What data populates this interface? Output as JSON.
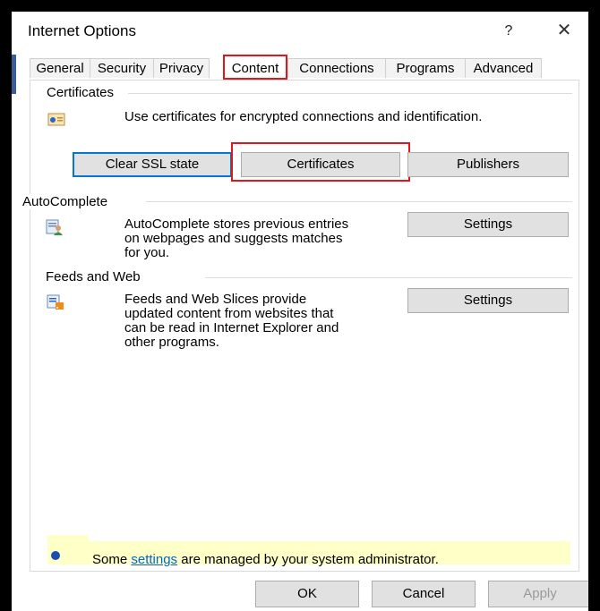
{
  "window": {
    "title": "Internet Options",
    "help_label": "?",
    "close_label": "✕"
  },
  "tabs": [
    {
      "label": "General"
    },
    {
      "label": "Security"
    },
    {
      "label": "Privacy"
    },
    {
      "label": "Content"
    },
    {
      "label": "Connections"
    },
    {
      "label": "Programs"
    },
    {
      "label": "Advanced"
    }
  ],
  "active_tab": "Content",
  "certificates": {
    "title": "Certificates",
    "description": "Use certificates for encrypted connections and identification.",
    "buttons": {
      "clear_ssl": "Clear SSL state",
      "certificates": "Certificates",
      "publishers": "Publishers"
    },
    "icon": "certificate-icon"
  },
  "autocomplete": {
    "title": "AutoComplete",
    "description": "AutoComplete stores previous entries\non webpages and suggests matches\nfor you.",
    "settings_label": "Settings",
    "icon": "autocomplete-icon"
  },
  "feeds": {
    "title": "Feeds and Web",
    "description": "Feeds and Web Slices provide\nupdated content from websites that\ncan be read in Internet Explorer and\nother programs.",
    "settings_label": "Settings",
    "icon": "feeds-icon"
  },
  "admin_notice": {
    "prefix": "Some ",
    "link": "settings",
    "suffix": " are managed by your system administrator.",
    "icon": "info-icon"
  },
  "footer": {
    "ok": "OK",
    "cancel": "Cancel",
    "apply": "Apply"
  },
  "colors": {
    "highlight_red": "#e0161d",
    "focus_blue": "#0078d7",
    "notice_yellow": "#ffffc8",
    "link_blue": "#0066cc"
  }
}
